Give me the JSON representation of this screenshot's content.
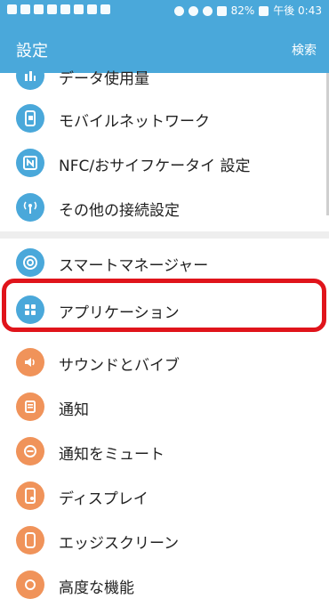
{
  "statusbar": {
    "battery": "82%",
    "time": "午後 0:43"
  },
  "header": {
    "title": "設定",
    "search": "検索"
  },
  "items": [
    {
      "label": "データ使用量",
      "icon": "data-usage-icon",
      "color": "#4aa8da"
    },
    {
      "label": "モバイルネットワーク",
      "icon": "mobile-network-icon",
      "color": "#4aa8da"
    },
    {
      "label": "NFC/おサイフケータイ 設定",
      "icon": "nfc-icon",
      "color": "#4aa8da"
    },
    {
      "label": "その他の接続設定",
      "icon": "connection-icon",
      "color": "#4aa8da"
    },
    {
      "label": "スマートマネージャー",
      "icon": "smart-manager-icon",
      "color": "#4aa8da"
    },
    {
      "label": "アプリケーション",
      "icon": "applications-icon",
      "color": "#4aa8da"
    },
    {
      "label": "サウンドとバイブ",
      "icon": "sound-icon",
      "color": "#f0935a"
    },
    {
      "label": "通知",
      "icon": "notification-icon",
      "color": "#f0935a"
    },
    {
      "label": "通知をミュート",
      "icon": "mute-icon",
      "color": "#f0935a"
    },
    {
      "label": "ディスプレイ",
      "icon": "display-icon",
      "color": "#f0935a"
    },
    {
      "label": "エッジスクリーン",
      "icon": "edge-screen-icon",
      "color": "#f0935a"
    },
    {
      "label": "高度な機能",
      "icon": "advanced-icon",
      "color": "#f0935a"
    }
  ],
  "highlight_color": "#e0141b"
}
